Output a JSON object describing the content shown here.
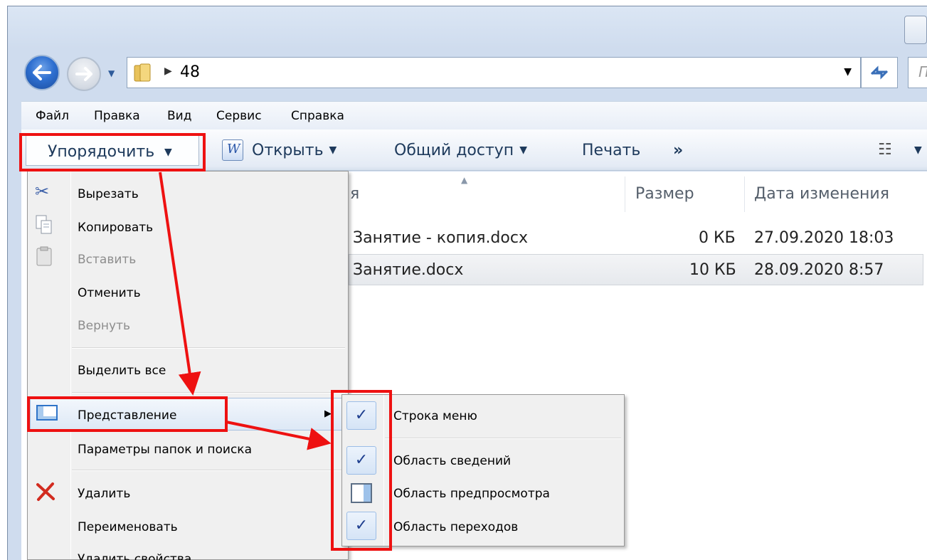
{
  "address": {
    "path": "48",
    "search_hint": "П"
  },
  "menubar": [
    "Файл",
    "Правка",
    "Вид",
    "Сервис",
    "Справка"
  ],
  "toolbar": {
    "organize": "Упорядочить",
    "open": "Открыть",
    "share": "Общий доступ",
    "print": "Печать",
    "more": "»"
  },
  "file_list": {
    "columns": {
      "name": "я",
      "size": "Размер",
      "date": "Дата изменения"
    },
    "rows": [
      {
        "name": "Занятие - копия.docx",
        "size": "0 КБ",
        "date": "27.09.2020 18:03"
      },
      {
        "name": "Занятие.docx",
        "size": "10 КБ",
        "date": "28.09.2020 8:57"
      }
    ]
  },
  "organize_menu": {
    "cut": "Вырезать",
    "copy": "Копировать",
    "paste": "Вставить",
    "undo": "Отменить",
    "redo": "Вернуть",
    "select_all": "Выделить все",
    "layout": "Представление",
    "folder_options": "Параметры папок и поиска",
    "delete": "Удалить",
    "rename": "Переименовать",
    "remove_properties": "Удалить свойства"
  },
  "layout_submenu": {
    "items": [
      {
        "label": "Строка меню",
        "checked": true
      },
      {
        "label": "Область сведений",
        "checked": true
      },
      {
        "label": "Область предпросмотра",
        "checked": false
      },
      {
        "label": "Область переходов",
        "checked": true
      }
    ],
    "check_mark": "✓"
  },
  "colors": {
    "annotation": "#ee1111",
    "accent": "#2e6fd0"
  }
}
